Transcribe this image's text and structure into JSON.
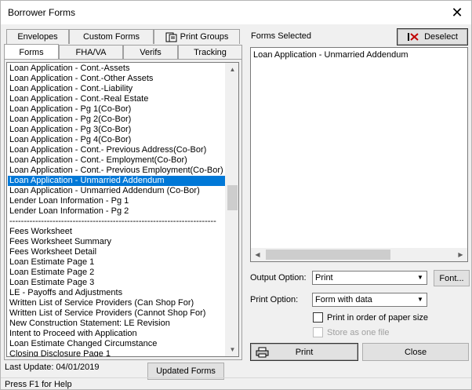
{
  "window": {
    "title": "Borrower Forms"
  },
  "tabs": {
    "row1": [
      "Envelopes",
      "Custom Forms",
      "Print Groups"
    ],
    "row2": [
      "Forms",
      "FHA/VA",
      "Verifs",
      "Tracking"
    ],
    "active": "Forms"
  },
  "forms_list": {
    "items": [
      "Loan Application - Cont.-Assets",
      "Loan Application - Cont.-Other Assets",
      "Loan Application - Cont.-Liability",
      "Loan Application - Cont.-Real Estate",
      "Loan Application - Pg 1(Co-Bor)",
      "Loan Application - Pg 2(Co-Bor)",
      "Loan Application - Pg 3(Co-Bor)",
      "Loan Application - Pg 4(Co-Bor)",
      "Loan Application - Cont.- Previous Address(Co-Bor)",
      "Loan Application - Cont.- Employment(Co-Bor)",
      "Loan Application - Cont.- Previous Employment(Co-Bor)",
      "Loan Application - Unmarried Addendum",
      "Loan Application - Unmarried Addendum (Co-Bor)",
      "Lender Loan Information - Pg 1",
      "Lender Loan Information - Pg 2",
      "------------------------------------------------------------------------",
      "Fees Worksheet",
      "Fees Worksheet Summary",
      "Fees Worksheet Detail",
      "Loan Estimate Page 1",
      "Loan Estimate Page 2",
      "Loan Estimate Page 3",
      "LE - Payoffs and Adjustments",
      "Written List of Service Providers (Can Shop For)",
      "Written List of Service Providers (Cannot Shop For)",
      "New Construction Statement: LE Revision",
      "Intent to Proceed with Application",
      "Loan Estimate Changed Circumstance",
      "Closing Disclosure Page 1"
    ],
    "selected_index": 11,
    "scroll_position": 0.45
  },
  "forms_selected": {
    "label": "Forms Selected",
    "deselect_label": "Deselect",
    "items": [
      "Loan Application - Unmarried Addendum"
    ]
  },
  "output_option": {
    "label": "Output Option:",
    "value": "Print",
    "font_label": "Font..."
  },
  "print_option": {
    "label": "Print Option:",
    "value": "Form with data"
  },
  "checkboxes": {
    "paper_order": {
      "label": "Print in order of paper size",
      "checked": false,
      "enabled": true
    },
    "store_as_one": {
      "label": "Store as one file",
      "checked": false,
      "enabled": false
    }
  },
  "actions": {
    "print_label": "Print",
    "close_label": "Close",
    "updated_forms_label": "Updated Forms"
  },
  "status": {
    "last_update": "Last Update: 04/01/2019",
    "help": "Press F1 for Help"
  },
  "colors": {
    "selection": "#0078d7",
    "window_bg": "#f0f0f0",
    "deselect_icon": "#c00000"
  }
}
